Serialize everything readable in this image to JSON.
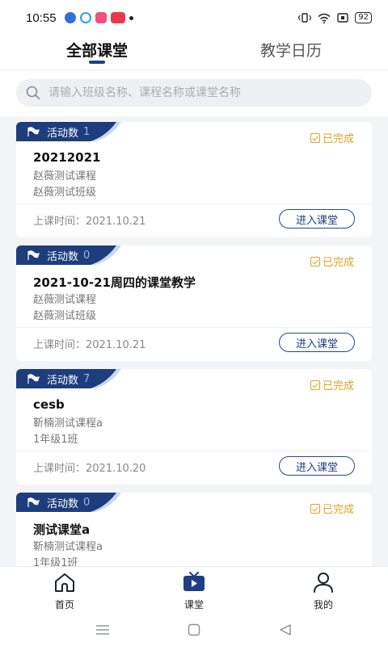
{
  "status": {
    "time": "10:55",
    "battery": "92"
  },
  "tabs": [
    {
      "label": "全部课堂",
      "active": true
    },
    {
      "label": "教学日历",
      "active": false
    }
  ],
  "search": {
    "placeholder": "请输入班级名称、课程名称或课堂名称"
  },
  "cards": [
    {
      "activity_label": "活动数",
      "activity_count": "1",
      "status": "已完成",
      "title": "20212021",
      "course": "赵薇测试课程",
      "class_name": "赵薇测试班级",
      "time": "上课时间：2021.10.21",
      "enter_label": "进入课堂"
    },
    {
      "activity_label": "活动数",
      "activity_count": "0",
      "status": "已完成",
      "title": "2021-10-21周四的课堂教学",
      "course": "赵薇测试课程",
      "class_name": "赵薇测试班级",
      "time": "上课时间：2021.10.21",
      "enter_label": "进入课堂"
    },
    {
      "activity_label": "活动数",
      "activity_count": "7",
      "status": "已完成",
      "title": "cesb",
      "course": "靳楠测试课程a",
      "class_name": "1年级1班",
      "time": "上课时间：2021.10.20",
      "enter_label": "进入课堂"
    },
    {
      "activity_label": "活动数",
      "activity_count": "0",
      "status": "已完成",
      "title": "测试课堂a",
      "course": "靳楠测试课程a",
      "class_name": "1年级1班",
      "time": "",
      "enter_label": ""
    }
  ],
  "nav": [
    {
      "label": "首页",
      "icon": "home-icon",
      "active": false
    },
    {
      "label": "课堂",
      "icon": "tv-icon",
      "active": true
    },
    {
      "label": "我的",
      "icon": "user-icon",
      "active": false
    }
  ],
  "colors": {
    "primary": "#1f3f82",
    "done": "#d9a42a",
    "badge_bg": "#1d3d7d",
    "badge_tail": "#c7d8ee"
  }
}
